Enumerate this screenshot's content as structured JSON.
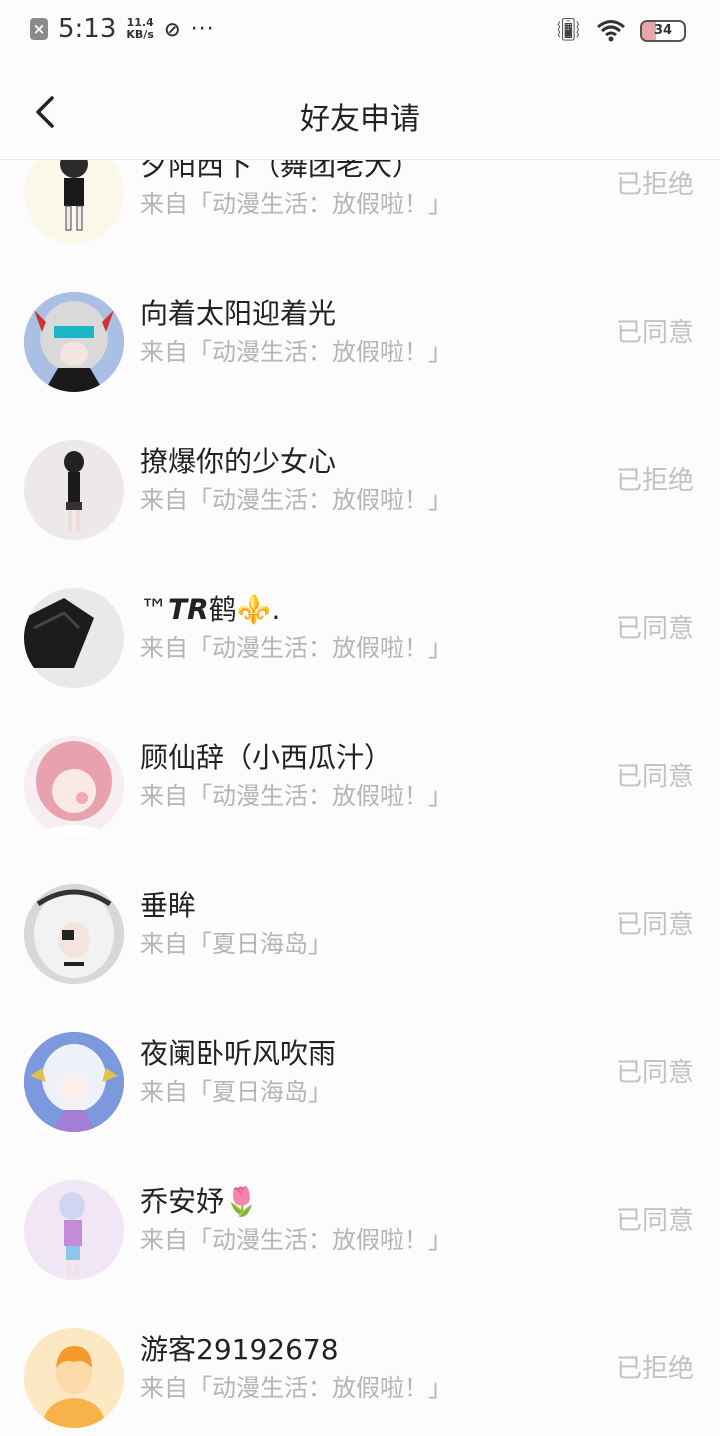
{
  "status_bar": {
    "time": "5:13",
    "speed_value": "11.4",
    "speed_unit": "KB/s",
    "more": "···",
    "battery": "34",
    "battery_level": 0.34
  },
  "header": {
    "title": "好友申请"
  },
  "requests": [
    {
      "name": "夕阳西下（舞团老大）",
      "source": "来自「动漫生活：放假啦！」",
      "status": "已拒绝"
    },
    {
      "name": "向着太阳迎着光",
      "source": "来自「动漫生活：放假啦！」",
      "status": "已同意"
    },
    {
      "name": "撩爆你的少女心",
      "source": "来自「动漫生活：放假啦！」",
      "status": "已拒绝"
    },
    {
      "name": "™𝙏𝙍鹤⚜️.",
      "source": "来自「动漫生活：放假啦！」",
      "status": "已同意"
    },
    {
      "name": "顾仙辞（小西瓜汁）",
      "source": "来自「动漫生活：放假啦！」",
      "status": "已同意"
    },
    {
      "name": "垂眸",
      "source": "来自「夏日海岛」",
      "status": "已同意"
    },
    {
      "name": "夜阑卧听风吹雨",
      "source": "来自「夏日海岛」",
      "status": "已同意"
    },
    {
      "name": "乔安妤🌷",
      "source": "来自「动漫生活：放假啦！」",
      "status": "已同意"
    },
    {
      "name": "游客29192678",
      "source": "来自「动漫生活：放假啦！」",
      "status": "已拒绝"
    }
  ]
}
